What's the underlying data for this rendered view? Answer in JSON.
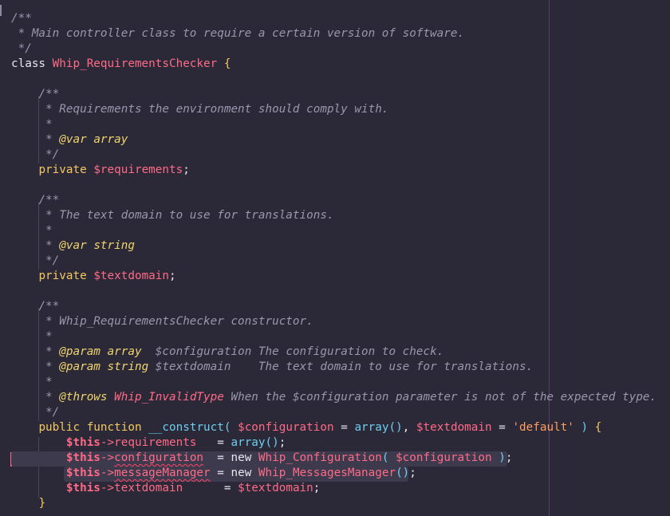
{
  "code": {
    "l1": "/**",
    "l2": " * Main controller class to require a certain version of software.",
    "l3": " */",
    "class_kw": "class",
    "class_name": "Whip_RequirementsChecker",
    "open_brace": "{",
    "doc_open": "/**",
    "doc_req": " * Requirements the environment should comply with.",
    "doc_star": " *",
    "doc_var_prefix": " * ",
    "var_tag": "@var",
    "type_array": "array",
    "type_string": "string",
    "doc_close": " */",
    "private_kw": "private",
    "prop_requirements": "$requirements",
    "prop_textdomain": "$textdomain",
    "semicolon": ";",
    "doc_td": " * The text domain to use for translations.",
    "doc_ctor": " * Whip_RequirementsChecker constructor.",
    "param_tag": "@param",
    "param1_rest": "  $configuration The configuration to check.",
    "param2_var": "$textdomain",
    "param2_rest": "    The text domain to use for translations.",
    "throws_tag": "@throws",
    "throws_class": "Whip_InvalidType",
    "throws_rest": " When the $configuration parameter is not of the expected type.",
    "public_kw": "public",
    "function_kw": "function",
    "ctor_name": "__construct",
    "ctor_param1": "$configuration",
    "ctor_eq": " = ",
    "array_fn": "array",
    "ctor_param2": "$textdomain",
    "ctor_default": "'default'",
    "this_kw": "$this",
    "arrow": "->",
    "field_requirements": "requirements",
    "field_configuration": "configuration",
    "field_messageManager": "messageManager",
    "field_textdomain": "textdomain",
    "new_kw": "new",
    "cls_config": "Whip_Configuration",
    "cls_messages": "Whip_MessagesManager",
    "arg_configuration": "$configuration",
    "val_textdomain": "$textdomain",
    "close_brace": "}"
  }
}
